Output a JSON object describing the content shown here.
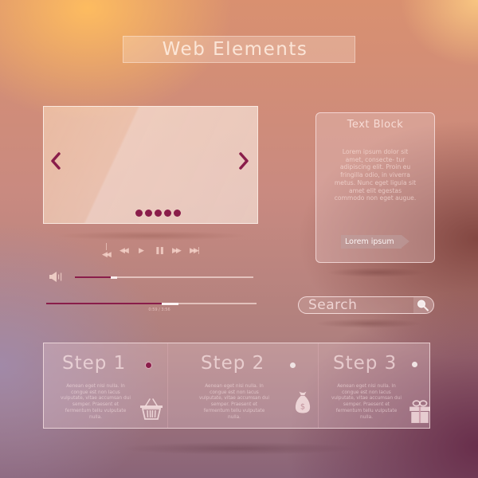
{
  "header": {
    "title": "Web Elements"
  },
  "carousel": {
    "prev_icon": "chevron-left-icon",
    "next_icon": "chevron-right-icon",
    "prev_glyph": "‹",
    "next_glyph": "›",
    "slide_count": 5,
    "accent_color": "#8a1d4a"
  },
  "media_controls": [
    {
      "name": "skip-to-start-button",
      "icon": "skip-back-icon",
      "glyph": "|◀◀"
    },
    {
      "name": "rewind-button",
      "icon": "rewind-icon",
      "glyph": "◀◀"
    },
    {
      "name": "play-button",
      "icon": "play-icon",
      "glyph": "▶"
    },
    {
      "name": "pause-button",
      "icon": "pause-icon",
      "glyph": "❚❚"
    },
    {
      "name": "fast-forward-button",
      "icon": "fast-forward-icon",
      "glyph": "▶▶"
    },
    {
      "name": "skip-to-end-button",
      "icon": "skip-forward-icon",
      "glyph": "▶▶|"
    }
  ],
  "volume": {
    "icon": "speaker-icon",
    "level_percent": 20
  },
  "progress": {
    "played_percent": 55,
    "buffered_percent": 63,
    "time_text": "0:59 / 3:56"
  },
  "text_block": {
    "title": "Text Block",
    "body": "Lorem ipsum dolor sit amet, consecte- tur adipiscing elit. Proin eu fringilla odio, in viverra metus. Nunc eget ligula sit amet elit egestas commodo non eget augue.",
    "button_label": "Lorem ipsum"
  },
  "search": {
    "placeholder": "Search",
    "icon": "search-icon"
  },
  "steps": [
    {
      "title": "Step 1",
      "body": "Aenean eget nisi nulla. In congue est non lacus vulputate, vitae accumsan dui semper. Praesent et fermentum tellu vulputate nulla.",
      "icon": "basket-icon",
      "active": true
    },
    {
      "title": "Step 2",
      "body": "Aenean eget nisi nulla. In congue est non lacus vulputate, vitae accumsan dui semper. Praesent et fermentum tellu vulputate nulla.",
      "icon": "money-bag-icon",
      "active": false
    },
    {
      "title": "Step 3",
      "body": "Aenean eget nisi nulla. In congue est non lacus vulputate, vitae accumsan dui semper. Praesent et fermentum tellu vulputate nulla.",
      "icon": "gift-icon",
      "active": false
    }
  ],
  "colors": {
    "accent": "#8a1d4a",
    "inactive_indicator": "#f0e4e4"
  }
}
